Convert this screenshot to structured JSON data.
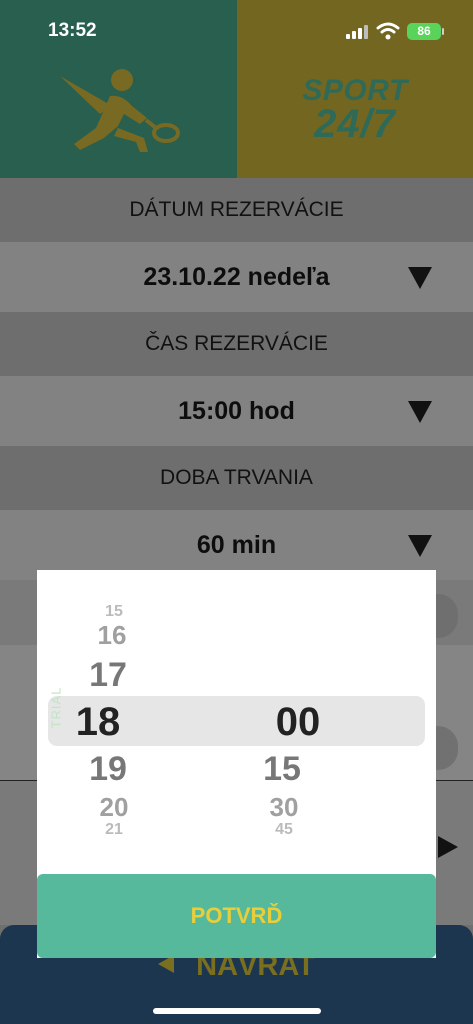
{
  "status_bar": {
    "time": "13:52",
    "battery": "86"
  },
  "header": {
    "brand_top": "SPORT",
    "brand_bottom": "24/7"
  },
  "form": {
    "date_label": "DÁTUM REZERVÁCIE",
    "date_value": "23.10.22 nedeľa",
    "time_label": "ČAS REZERVÁCIE",
    "time_value": "15:00 hod",
    "duration_label": "DOBA TRVANIA",
    "duration_value": "60 min"
  },
  "picker": {
    "watermark": "TRIAL",
    "hours": [
      "15",
      "16",
      "17",
      "18",
      "19",
      "20",
      "21"
    ],
    "minutes": [
      "00",
      "15",
      "30",
      "45"
    ],
    "selected_hour": "18",
    "selected_minute": "00",
    "confirm_label": "POTVRĎ"
  },
  "nav": {
    "back_label": "NÁVRAT"
  },
  "colors": {
    "header_left": "#285f4f",
    "header_right": "#736620",
    "confirm_button": "#56b99c",
    "confirm_text": "#e8cf3a",
    "nav_bg": "#1d3650"
  }
}
